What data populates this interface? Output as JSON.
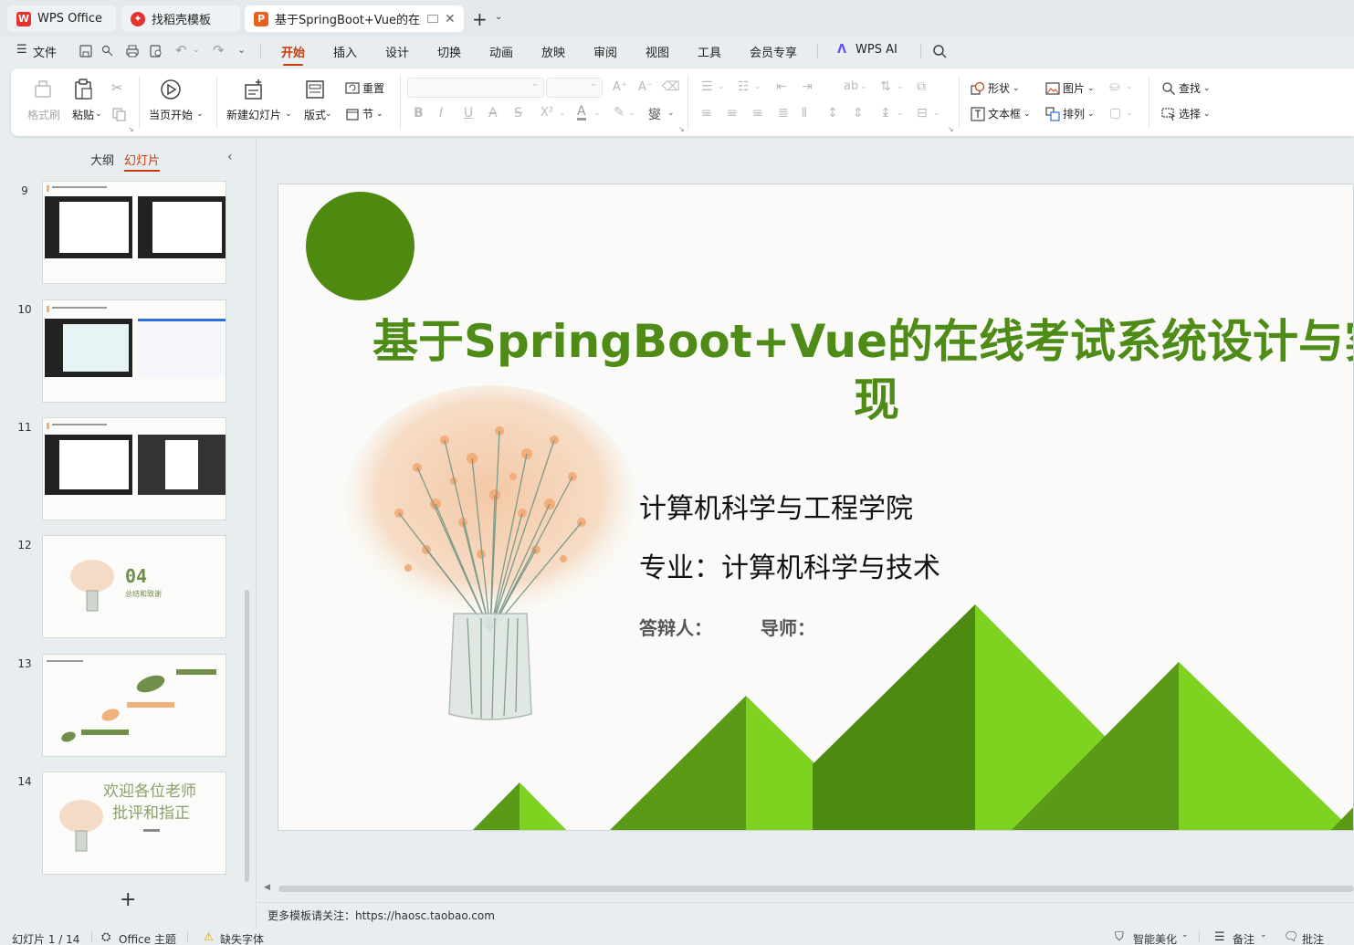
{
  "tabs": [
    {
      "label": "WPS Office"
    },
    {
      "label": "找稻壳模板"
    },
    {
      "label": "基于SpringBoot+Vue的在线"
    }
  ],
  "menu": {
    "file": "文件",
    "items": [
      "开始",
      "插入",
      "设计",
      "切换",
      "动画",
      "放映",
      "审阅",
      "视图",
      "工具",
      "会员专享"
    ],
    "wps_ai": "WPS AI"
  },
  "ribbon": {
    "format_painter": "格式刷",
    "paste": "粘贴",
    "from_current": "当页开始",
    "new_slide": "新建幻灯片",
    "layout": "版式",
    "reset": "重置",
    "section": "节",
    "shape": "形状",
    "picture": "图片",
    "textbox": "文本框",
    "arrange": "排列",
    "find": "查找",
    "select": "选择"
  },
  "panel": {
    "outline_tab": "大纲",
    "slides_tab": "幻灯片"
  },
  "thumbnails": [
    {
      "number": "9"
    },
    {
      "number": "10"
    },
    {
      "number": "11"
    },
    {
      "number": "12",
      "big": "04",
      "sub": "总结和致谢"
    },
    {
      "number": "13"
    },
    {
      "number": "14",
      "line1": "欢迎各位老师",
      "line2": "批评和指正"
    }
  ],
  "slide": {
    "title_line1": "基于SpringBoot+Vue的在线考试系统设计与实",
    "title_line2": "现",
    "college": "计算机科学与工程学院",
    "major": "专业：计算机科学与技术",
    "defender": "答辩人：",
    "advisor": "导师："
  },
  "notes_hint": "更多模板请关注：https://haosc.taobao.com",
  "status": {
    "slide_count": "幻灯片 1 / 14",
    "theme": "Office 主题",
    "missing_font": "缺失字体",
    "smart_beautify": "智能美化",
    "notes": "备注",
    "comments": "批注"
  },
  "colors": {
    "accent": "#c73c0e",
    "title_green": "#4e8b17",
    "circle_green": "#4f8a10",
    "mountain_light": "#7ed321",
    "mountain_dark": "#5b9a16"
  }
}
